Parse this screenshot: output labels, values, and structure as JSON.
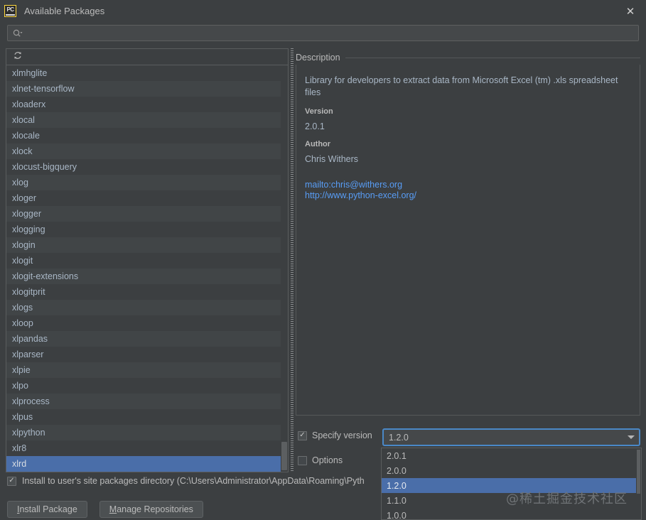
{
  "window": {
    "title": "Available Packages",
    "logo_text": "PC",
    "close_label": "✕"
  },
  "search": {
    "value": "",
    "placeholder": "",
    "icon": "search-icon"
  },
  "package_list": {
    "refresh_icon": "refresh-icon",
    "selected": "xlrd",
    "items": [
      "xlmhglite",
      "xlnet-tensorflow",
      "xloaderx",
      "xlocal",
      "xlocale",
      "xlock",
      "xlocust-bigquery",
      "xlog",
      "xloger",
      "xlogger",
      "xlogging",
      "xlogin",
      "xlogit",
      "xlogit-extensions",
      "xlogitprit",
      "xlogs",
      "xloop",
      "xlpandas",
      "xlparser",
      "xlpie",
      "xlpo",
      "xlprocess",
      "xlpus",
      "xlpython",
      "xlr8",
      "xlrd"
    ]
  },
  "description": {
    "legend": "Description",
    "summary": "Library for developers to extract data from Microsoft Excel (tm) .xls spreadsheet files",
    "version_label": "Version",
    "version_value": "2.0.1",
    "author_label": "Author",
    "author_value": "Chris Withers",
    "links": [
      "mailto:chris@withers.org",
      "http://www.python-excel.org/"
    ]
  },
  "version_controls": {
    "specify_version_label": "Specify version",
    "specify_version_checked": true,
    "options_label": "Options",
    "options_checked": false,
    "combo_value": "1.2.0",
    "combo_arrow_icon": "chevron-down-icon",
    "dropdown_selected": "1.2.0",
    "dropdown_options": [
      "2.0.1",
      "2.0.0",
      "1.2.0",
      "1.1.0",
      "1.0.0"
    ]
  },
  "footer": {
    "install_user_checked": true,
    "install_user_label": "Install to user's site packages directory (C:\\Users\\Administrator\\AppData\\Roaming\\Pyth",
    "install_button": {
      "mnemonic": "I",
      "rest": "nstall Package"
    },
    "manage_button": {
      "mnemonic": "M",
      "rest": "anage Repositories"
    }
  },
  "watermark": "@稀土掘金技术社区",
  "colors": {
    "background": "#3c3f41",
    "selection": "#4a6ea9",
    "link": "#589df6",
    "focus_border": "#4a88c7",
    "text": "#bbbbbb",
    "list_text": "#a9b7c6",
    "logo_accent": "#ffd83d"
  }
}
